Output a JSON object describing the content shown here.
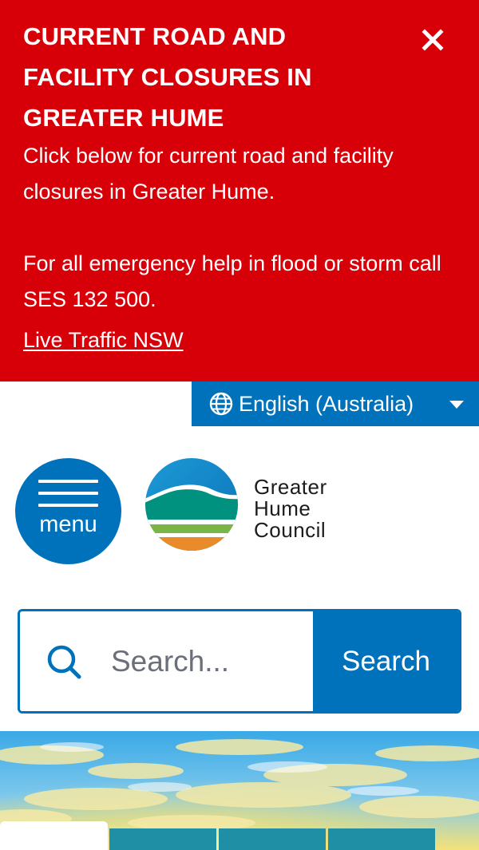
{
  "alert": {
    "title": "CURRENT ROAD AND FACILITY CLOSURES IN GREATER HUME",
    "body_line_1": "Click below for current road and facility closures in Greater Hume.",
    "body_line_2": "For all emergency help in flood or storm call SES 132 500.",
    "link_text": "Live Traffic NSW",
    "close_icon": "close-icon",
    "background_color": "#d80008"
  },
  "language": {
    "label": "English (Australia)",
    "icon": "globe-icon",
    "caret_icon": "caret-down-icon"
  },
  "header": {
    "menu_label": "menu",
    "menu_icon": "hamburger-icon",
    "logo": {
      "line_1": "Greater",
      "line_2": "Hume",
      "line_3": "Council"
    }
  },
  "search": {
    "placeholder": "Search...",
    "value": "",
    "button_label": "Search",
    "icon": "search-icon"
  },
  "colors": {
    "primary_blue": "#0072bc",
    "alert_red": "#d80008",
    "logo_teal": "#00927f",
    "logo_orange": "#e98b2a"
  }
}
